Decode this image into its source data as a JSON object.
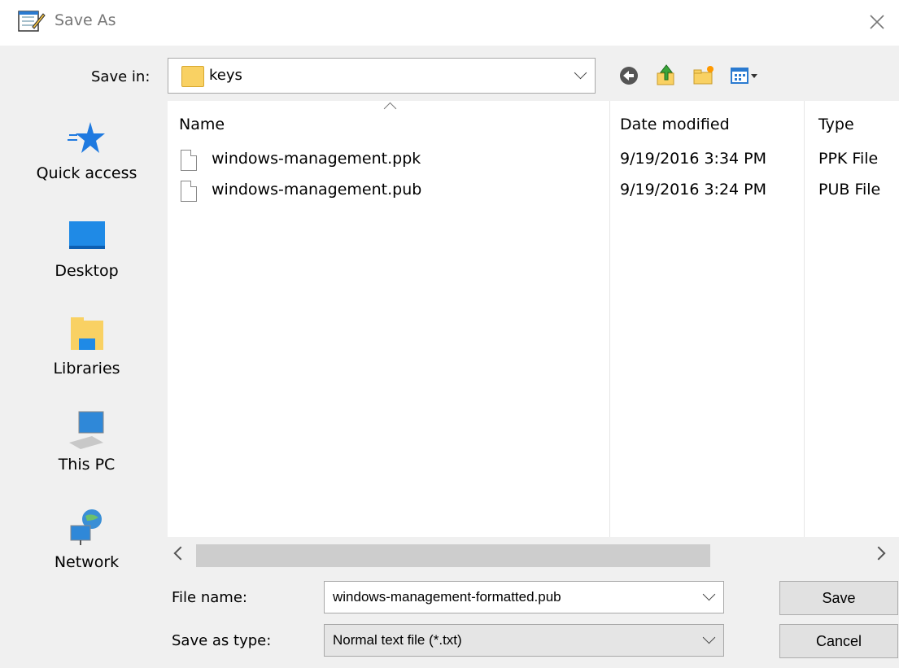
{
  "window": {
    "title": "Save As",
    "close_icon": "close-icon"
  },
  "save_in": {
    "label": "Save in:",
    "value": "keys"
  },
  "toolbar": {
    "icons": [
      "back-icon",
      "up-folder-icon",
      "new-folder-icon",
      "view-menu-icon"
    ]
  },
  "sidebar": {
    "items": [
      {
        "label": "Quick access",
        "icon": "star-icon"
      },
      {
        "label": "Desktop",
        "icon": "desktop-icon"
      },
      {
        "label": "Libraries",
        "icon": "libraries-icon"
      },
      {
        "label": "This PC",
        "icon": "computer-icon"
      },
      {
        "label": "Network",
        "icon": "network-icon"
      }
    ]
  },
  "file_list": {
    "columns": [
      "Name",
      "Date modified",
      "Type"
    ],
    "rows": [
      {
        "name": "windows-management.ppk",
        "date": "9/19/2016 3:34 PM",
        "type": "PPK File"
      },
      {
        "name": "windows-management.pub",
        "date": "9/19/2016 3:24 PM",
        "type": "PUB File"
      }
    ]
  },
  "file_name": {
    "label": "File name:",
    "value": "windows-management-formatted.pub"
  },
  "save_as_type": {
    "label": "Save as type:",
    "value": "Normal text file (*.txt)"
  },
  "buttons": {
    "save": "Save",
    "cancel": "Cancel"
  },
  "colors": {
    "accent": "#1f7ae0",
    "folder": "#f9d163"
  }
}
